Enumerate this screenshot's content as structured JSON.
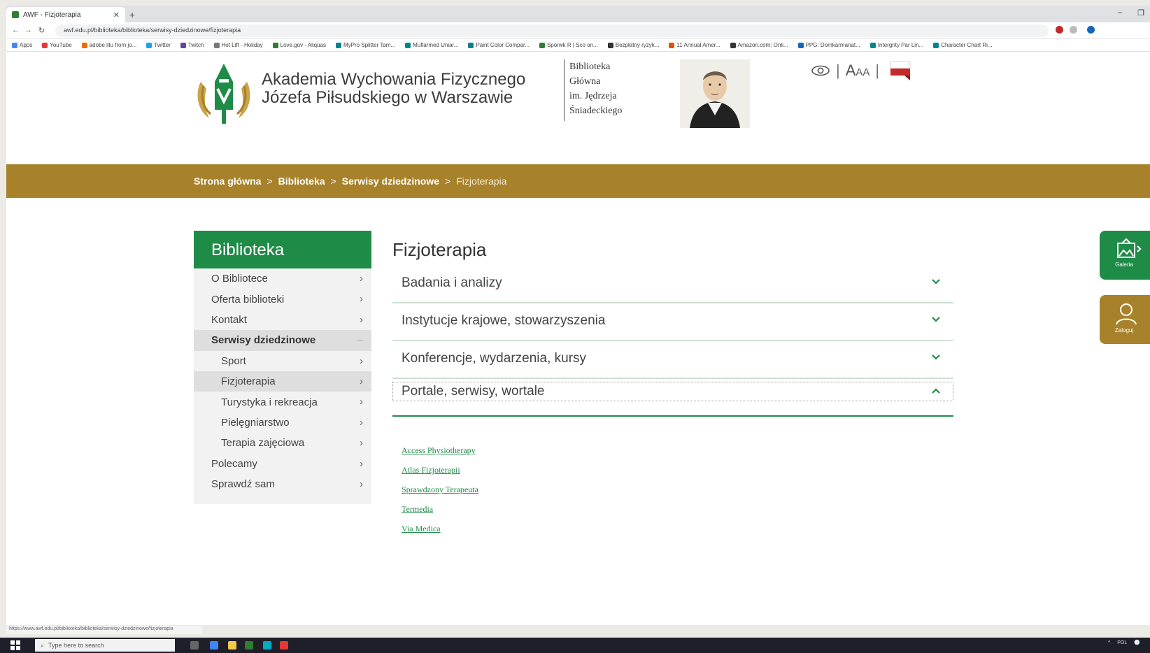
{
  "browser": {
    "tab_title": "AWF - Fizjoterapia",
    "address": "awf.edu.pl/biblioteka/biblioteka/serwisy-dziedzinowe/fizjoterapia",
    "bookmarks": [
      "Apps",
      "YouTube",
      "adobe illu from jo...",
      "Twitter",
      "Twitch",
      "Hot Lift - Holiday",
      "Love.gov - Aliquas",
      "MyPro Splitter Tam...",
      "Muflarmed Uniar...",
      "Paint Color Compar...",
      "Sporwk R | Sco on...",
      "Bezpłatny ryzyk...",
      "11 Annual Amer...",
      "Amazon.com: Onli...",
      "PPG: Domkarmanat...",
      "Intergrity Par Lin...",
      "Character Chart Ri..."
    ],
    "status_url": "https://www.awf.edu.pl/biblioteka/biblioteka/serwisy-dziedzinowe/fizjoterapia"
  },
  "header": {
    "university_line1": "Akademia Wychowania Fizycznego",
    "university_line2": "Józefa Piłsudskiego w Warszawie",
    "library_lines": [
      "Biblioteka",
      "Główna",
      "im. Jędrzeja",
      "Śniadeckiego"
    ],
    "font_tool_big": "A",
    "font_tool_small": "AA",
    "separator": "|"
  },
  "breadcrumb": {
    "items": [
      "Strona główna",
      "Biblioteka",
      "Serwisy dziedzinowe"
    ],
    "separator": ">",
    "current": "Fizjoterapia"
  },
  "sidebar": {
    "title": "Biblioteka",
    "items": [
      {
        "label": "O Bibliotece"
      },
      {
        "label": "Oferta biblioteki"
      },
      {
        "label": "Kontakt"
      },
      {
        "label": "Serwisy dziedzinowe"
      },
      {
        "label": "Sport"
      },
      {
        "label": "Fizjoterapia"
      },
      {
        "label": "Turystyka i rekreacja"
      },
      {
        "label": "Pielęgniarstwo"
      },
      {
        "label": "Terapia zajęciowa"
      },
      {
        "label": "Polecamy"
      },
      {
        "label": "Sprawdź sam"
      }
    ]
  },
  "main": {
    "title": "Fizjoterapia",
    "accordion": [
      {
        "label": "Badania i analizy",
        "expanded": false
      },
      {
        "label": "Instytucje krajowe, stowarzyszenia",
        "expanded": false
      },
      {
        "label": "Konferencje, wydarzenia, kursy",
        "expanded": false
      },
      {
        "label": "Portale, serwisy, wortale",
        "expanded": true
      }
    ],
    "links": [
      "Access Physiotherapy",
      "Atlas Fizjoterapii",
      "Sprawdzony Terapeuta",
      "Termedia",
      "Via Medica"
    ]
  },
  "floating": {
    "gallery_label": "Galeria",
    "login_label": "Zaloguj"
  },
  "taskbar": {
    "search_placeholder": "Type here to search",
    "lang": "POL"
  },
  "colors": {
    "brand_green": "#1e8b47",
    "brand_gold": "#a8822b"
  }
}
